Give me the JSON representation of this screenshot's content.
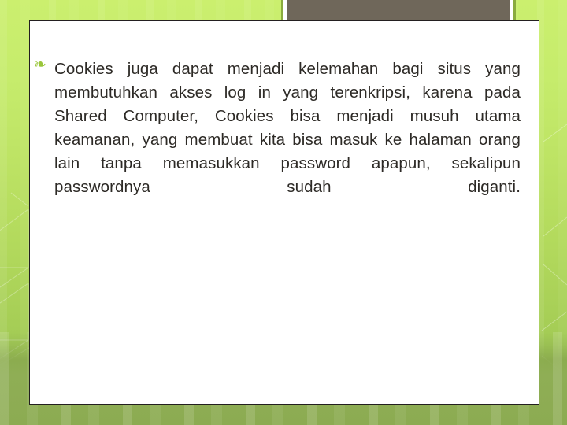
{
  "slide": {
    "theme_colors": {
      "background_top": "#cbef6e",
      "background_bottom": "#8cab52",
      "title_fill": "#6f675a",
      "title_border": "#8aab3e",
      "body_text": "#2d2a26",
      "bullet_color": "#9ac63a",
      "content_border": "#231f20",
      "content_fill": "#ffffff"
    },
    "title": {
      "text": "",
      "placeholder": ""
    },
    "content": {
      "bullets": [
        {
          "glyph": "bullet-leaf-icon",
          "symbol": "❧",
          "text": "Cookies juga dapat menjadi kelemahan bagi situs yang membutuhkan akses log in yang terenkripsi, karena pada Shared Computer, Cookies bisa menjadi musuh utama keamanan, yang membuat kita bisa masuk ke halaman orang lain tanpa memasukkan password apapun, sekalipun passwordnya sudah diganti."
        }
      ]
    }
  }
}
